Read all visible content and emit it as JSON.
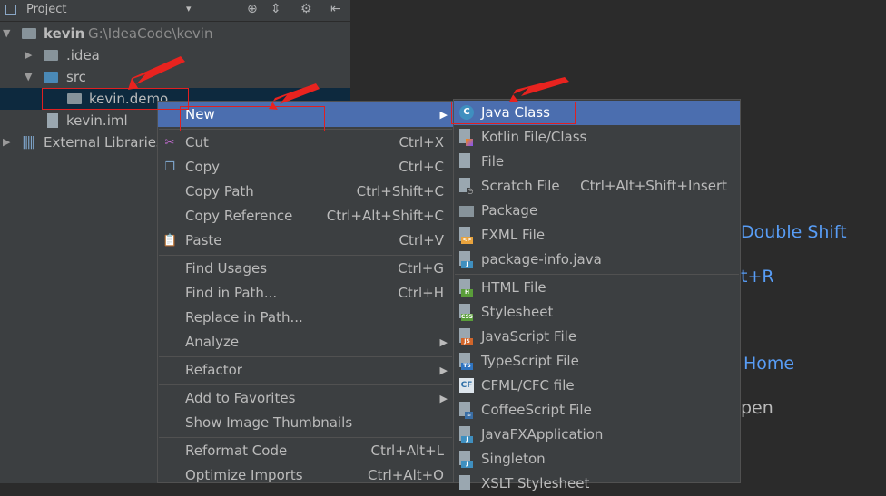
{
  "project_panel": {
    "header": {
      "title": "Project",
      "caret": "▾"
    },
    "tree": [
      {
        "label": "kevin",
        "path": "G:\\IdeaCode\\kevin"
      },
      {
        "label": ".idea"
      },
      {
        "label": "src"
      },
      {
        "label": "kevin.demo"
      },
      {
        "label": "kevin.iml"
      },
      {
        "label": "External Libraries"
      }
    ]
  },
  "editor_hints": [
    {
      "text": "Double Shift"
    },
    {
      "text": "t+R"
    },
    {
      "text": "Home"
    },
    {
      "text": "pen"
    }
  ],
  "context_menu": {
    "items": {
      "new": {
        "label": "New"
      },
      "cut": {
        "label": "Cut",
        "shortcut": "Ctrl+X"
      },
      "copy": {
        "label": "Copy",
        "shortcut": "Ctrl+C"
      },
      "copy_path": {
        "label": "Copy Path",
        "shortcut": "Ctrl+Shift+C"
      },
      "copy_reference": {
        "label": "Copy Reference",
        "shortcut": "Ctrl+Alt+Shift+C"
      },
      "paste": {
        "label": "Paste",
        "shortcut": "Ctrl+V"
      },
      "find_usages": {
        "label": "Find Usages",
        "shortcut": "Ctrl+G"
      },
      "find_in_path": {
        "label": "Find in Path...",
        "shortcut": "Ctrl+H"
      },
      "replace_in_path": {
        "label": "Replace in Path..."
      },
      "analyze": {
        "label": "Analyze"
      },
      "refactor": {
        "label": "Refactor"
      },
      "add_to_favorites": {
        "label": "Add to Favorites"
      },
      "show_image_thumbnails": {
        "label": "Show Image Thumbnails"
      },
      "reformat_code": {
        "label": "Reformat Code",
        "shortcut": "Ctrl+Alt+L"
      },
      "optimize_imports": {
        "label": "Optimize Imports",
        "shortcut": "Ctrl+Alt+O"
      }
    }
  },
  "new_submenu": {
    "items": [
      {
        "label": "Java Class",
        "icon": "java-class-icon"
      },
      {
        "label": "Kotlin File/Class",
        "icon": "kotlin-icon"
      },
      {
        "label": "File",
        "icon": "file-icon"
      },
      {
        "label": "Scratch File",
        "shortcut": "Ctrl+Alt+Shift+Insert",
        "icon": "scratch-file-icon"
      },
      {
        "label": "Package",
        "icon": "package-icon"
      },
      {
        "label": "FXML File",
        "icon": "fxml-icon"
      },
      {
        "label": "package-info.java",
        "icon": "java-file-icon"
      },
      {
        "label": "HTML File",
        "icon": "html-icon"
      },
      {
        "label": "Stylesheet",
        "icon": "css-icon"
      },
      {
        "label": "JavaScript File",
        "icon": "javascript-icon"
      },
      {
        "label": "TypeScript File",
        "icon": "typescript-icon"
      },
      {
        "label": "CFML/CFC file",
        "icon": "cfml-icon"
      },
      {
        "label": "CoffeeScript File",
        "icon": "coffeescript-icon"
      },
      {
        "label": "JavaFXApplication",
        "icon": "javafx-icon"
      },
      {
        "label": "Singleton",
        "icon": "singleton-icon"
      },
      {
        "label": "XSLT Stylesheet",
        "icon": "xslt-icon"
      }
    ]
  },
  "theme": {
    "selection": "#4b6eaf",
    "panel_bg": "#3c3f41",
    "editor_bg": "#2b2b2b",
    "annotation_red": "#e02020"
  }
}
